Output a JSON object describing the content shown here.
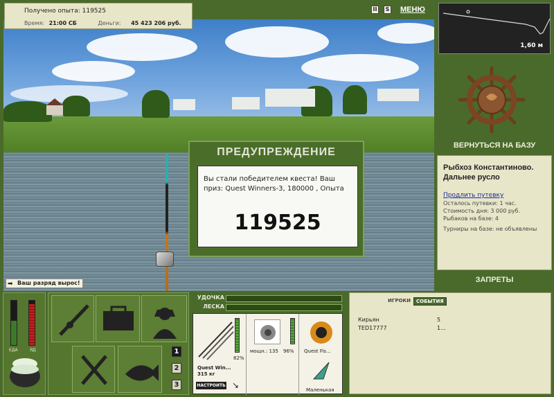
{
  "top": {
    "xp_label": "Получено опыта:",
    "xp_value": "119525",
    "time_label": "Время:",
    "time_value": "21:00 СБ",
    "money_label": "Деньги:",
    "money_value": "45 423 206 руб.",
    "btn_pause": "II",
    "btn_s": "S",
    "menu": "МЕНЮ"
  },
  "depth": {
    "value": "1,60 м"
  },
  "right": {
    "back_to_base": "ВЕРНУТЬСЯ НА БАЗУ",
    "base_title": "Рыбхоз Константиново. Дальнее русло",
    "extend_link": "Продлить путевку",
    "rows": [
      "Осталось путевки: 1 час.",
      "Стоимость дня: 3 000 руб.",
      "Рыбаков на базе: 4",
      "Турниры на базе: не объявлены"
    ],
    "bans": "ЗАПРЕТЫ"
  },
  "dialog": {
    "title": "ПРЕДУПРЕЖДЕНИЕ",
    "message": "Вы стали победителем квеста! Ваш приз: Quest Winners-3, 180000 , Опыта",
    "big_number": "119525"
  },
  "rank": "Ваш разряд вырос!",
  "gauges": {
    "food_label": "ЕДА",
    "poison_label": "ЯД",
    "food_level": 0.55,
    "poison_level": 0.92
  },
  "inventory": {
    "pages": [
      "1",
      "2",
      "3"
    ]
  },
  "tackle": {
    "rod_label": "УДОЧКА",
    "line_label": "ЛЕСКА",
    "rod_name": "Quest Win...",
    "rod_weight": "315 кг",
    "rod_pct": "82%",
    "reel_label": "мощн.: 135",
    "reel_pct": "96%",
    "line_name": "Quest Fis...",
    "lure_name": "Маленькая",
    "setup_btn": "НАСТРОИТЬ"
  },
  "players": {
    "tab_players": "ИГРОКИ",
    "tab_events": "СОБЫТИЯ",
    "rows": [
      {
        "name": "Кирьян",
        "value": "5"
      },
      {
        "name": "TED17777",
        "value": "1..."
      }
    ]
  }
}
